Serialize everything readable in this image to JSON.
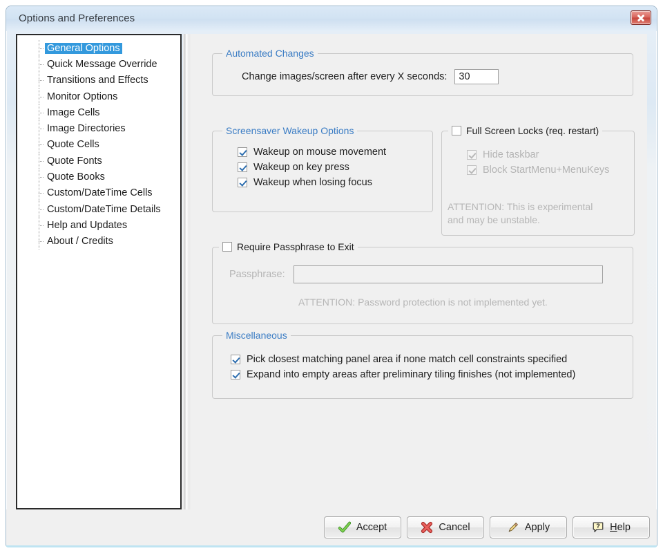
{
  "window": {
    "title": "Options and Preferences",
    "close_icon": "close-icon"
  },
  "sidebar": {
    "items": [
      {
        "label": "General Options",
        "selected": true
      },
      {
        "label": "Quick Message Override",
        "selected": false
      },
      {
        "label": "Transitions and Effects",
        "selected": false
      },
      {
        "label": "Monitor Options",
        "selected": false
      },
      {
        "label": "Image Cells",
        "selected": false
      },
      {
        "label": "Image Directories",
        "selected": false
      },
      {
        "label": "Quote Cells",
        "selected": false
      },
      {
        "label": "Quote Fonts",
        "selected": false
      },
      {
        "label": "Quote Books",
        "selected": false
      },
      {
        "label": "Custom/DateTime Cells",
        "selected": false
      },
      {
        "label": "Custom/DateTime Details",
        "selected": false
      },
      {
        "label": "Help and Updates",
        "selected": false
      },
      {
        "label": "About / Credits",
        "selected": false
      }
    ]
  },
  "automated_changes": {
    "title": "Automated Changes",
    "interval_label": "Change images/screen after every X seconds:",
    "interval_value": "30"
  },
  "wakeup": {
    "title": "Screensaver Wakeup Options",
    "options": [
      {
        "label": "Wakeup on mouse movement",
        "checked": true
      },
      {
        "label": "Wakeup on key press",
        "checked": true
      },
      {
        "label": "Wakeup when losing focus",
        "checked": true
      }
    ]
  },
  "fullscreen_locks": {
    "title": "Full Screen Locks (req. restart)",
    "enabled": false,
    "options": [
      {
        "label": "Hide taskbar",
        "checked": true
      },
      {
        "label": "Block StartMenu+MenuKeys",
        "checked": true
      }
    ],
    "note": "ATTENTION: This is experimental\nand may be unstable."
  },
  "passphrase": {
    "title": "Require Passphrase to Exit",
    "enabled": false,
    "field_label": "Passphrase:",
    "field_value": "",
    "field_placeholder": "",
    "note": "ATTENTION: Password protection is not implemented yet."
  },
  "miscellaneous": {
    "title": "Miscellaneous",
    "options": [
      {
        "label": "Pick closest matching panel area if none match cell constraints specified",
        "checked": true
      },
      {
        "label": "Expand into empty areas after preliminary tiling finishes (not implemented)",
        "checked": true
      }
    ]
  },
  "buttons": {
    "accept": {
      "label": "Accept",
      "icon": "green-check-icon"
    },
    "cancel": {
      "label": "Cancel",
      "icon": "red-x-icon"
    },
    "apply": {
      "label": "Apply",
      "icon": "pencil-icon"
    },
    "help": {
      "label": "Help",
      "label_prefix": "",
      "accel": "H",
      "label_rest": "elp",
      "icon": "question-bubble-icon"
    }
  },
  "colors": {
    "accent_blue": "#3a7cc4",
    "selection_blue": "#3399dd",
    "close_red": "#c6453c",
    "disabled_gray": "#b4b4b4"
  }
}
